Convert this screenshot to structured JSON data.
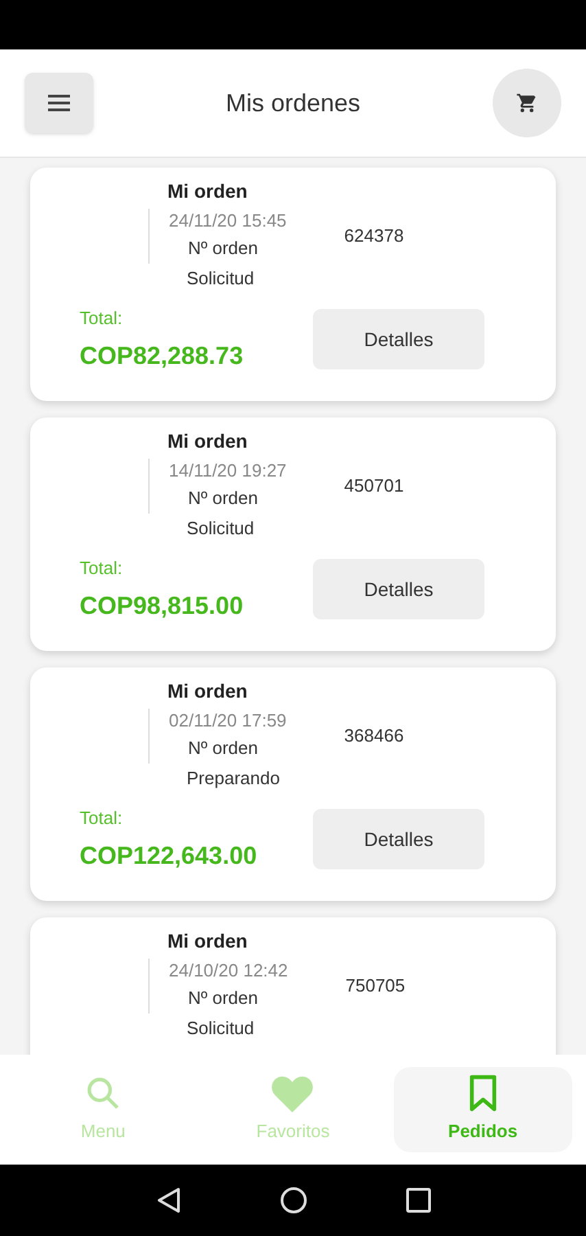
{
  "header": {
    "title": "Mis ordenes"
  },
  "orders": [
    {
      "title": "Mi orden",
      "date": "24/11/20 15:45",
      "order_label": "Nº orden",
      "order_number": "624378",
      "status": "Solicitud",
      "total_label": "Total:",
      "total": "COP82,288.73",
      "button": "Detalles"
    },
    {
      "title": "Mi orden",
      "date": "14/11/20 19:27",
      "order_label": "Nº orden",
      "order_number": "450701",
      "status": "Solicitud",
      "total_label": "Total:",
      "total": "COP98,815.00",
      "button": "Detalles"
    },
    {
      "title": "Mi orden",
      "date": "02/11/20 17:59",
      "order_label": "Nº orden",
      "order_number": "368466",
      "status": "Preparando",
      "total_label": "Total:",
      "total": "COP122,643.00",
      "button": "Detalles"
    },
    {
      "title": "Mi orden",
      "date": "24/10/20 12:42",
      "order_label": "Nº orden",
      "order_number": "750705",
      "status": "Solicitud"
    }
  ],
  "bottom_nav": [
    {
      "kind": "search",
      "label": "Menu",
      "selected": false
    },
    {
      "kind": "heart",
      "label": "Favoritos",
      "selected": false
    },
    {
      "kind": "bookmark",
      "label": "Pedidos",
      "selected": true
    }
  ]
}
